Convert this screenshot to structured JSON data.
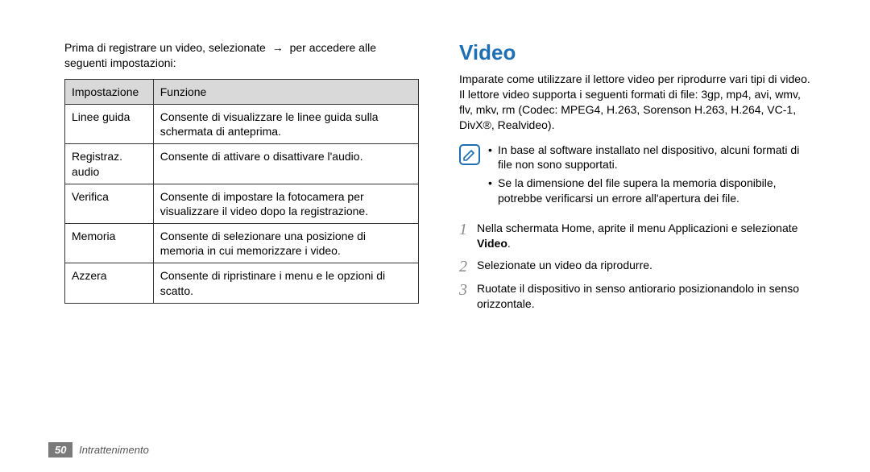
{
  "left": {
    "intro_pre": "Prima di registrare un video, selezionate",
    "arrow": "→",
    "intro_post": "per accedere alle seguenti impostazioni:",
    "table": {
      "head": {
        "c1": "Impostazione",
        "c2": "Funzione"
      },
      "rows": [
        {
          "c1": "Linee guida",
          "c2": "Consente di visualizzare le linee guida sulla schermata di anteprima."
        },
        {
          "c1": "Registraz. audio",
          "c2": "Consente di attivare o disattivare l'audio."
        },
        {
          "c1": "Verifica",
          "c2": "Consente di impostare la fotocamera per visualizzare il video dopo la registrazione."
        },
        {
          "c1": "Memoria",
          "c2": "Consente di selezionare una posizione di memoria in cui memorizzare i video."
        },
        {
          "c1": "Azzera",
          "c2": "Consente di ripristinare i menu e le opzioni di scatto."
        }
      ]
    }
  },
  "right": {
    "heading": "Video",
    "para": "Imparate come utilizzare il lettore video per riprodurre vari tipi di video. Il lettore video supporta i seguenti formati di file: 3gp, mp4, avi, wmv, flv, mkv, rm (Codec: MPEG4, H.263, Sorenson H.263, H.264, VC-1, DivX®, Realvideo).",
    "notes": [
      "In base al software installato nel dispositivo, alcuni formati di file non sono supportati.",
      "Se la dimensione del file supera la memoria disponibile, potrebbe verificarsi un errore all'apertura dei file."
    ],
    "steps": [
      {
        "n": "1",
        "pre": "Nella schermata Home, aprite il menu Applicazioni e selezionate ",
        "bold": "Video",
        "post": "."
      },
      {
        "n": "2",
        "pre": "Selezionate un video da riprodurre.",
        "bold": "",
        "post": ""
      },
      {
        "n": "3",
        "pre": "Ruotate il dispositivo in senso antiorario posizionandolo in senso orizzontale.",
        "bold": "",
        "post": ""
      }
    ]
  },
  "footer": {
    "page": "50",
    "section": "Intrattenimento"
  }
}
